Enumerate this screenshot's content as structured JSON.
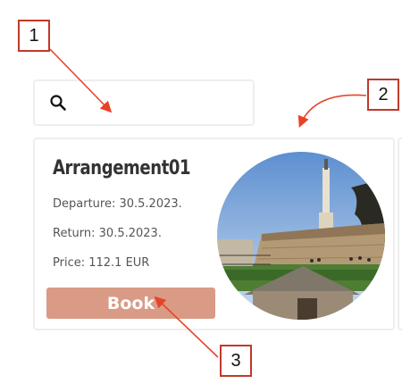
{
  "callouts": [
    "1",
    "2",
    "3"
  ],
  "search": {
    "placeholder": "",
    "icon": "search-icon"
  },
  "card": {
    "title": "Arrangement01",
    "departure": "Departure: 30.5.2023.",
    "return": "Return: 30.5.2023.",
    "price": "Price: 112.1 EUR",
    "book_label": "Book"
  },
  "colors": {
    "callout_border": "#c0392b",
    "arrow": "#e8432a",
    "book_button": "#d99b86",
    "card_border": "#eeeeee"
  }
}
